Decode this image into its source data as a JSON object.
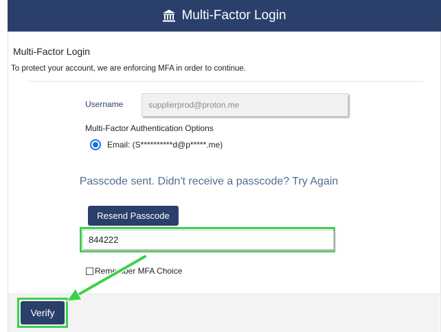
{
  "header": {
    "title": "Multi-Factor Login",
    "icon": "bank-icon"
  },
  "panel": {
    "title": "Multi-Factor Login",
    "subtitle": "To protect your account, we are enforcing MFA in order to continue."
  },
  "form": {
    "username_label": "Username",
    "username_value": "supplierprod@proton.me",
    "mfa_options_label": "Multi-Factor Authentication Options",
    "email_option_label": "Email: (S**********d@p*****.me)",
    "email_option_selected": true,
    "passcode_message": "Passcode sent. Didn't receive a passcode? Try Again",
    "resend_button": "Resend Passcode",
    "passcode_value": "844222",
    "remember_label": "Remember MFA Choice",
    "remember_checked": false
  },
  "footer": {
    "verify_button": "Verify"
  },
  "annotations": {
    "highlight_color": "#3bd14a",
    "arrow_color": "#3bd14a"
  },
  "colors": {
    "primary": "#2b3f6b",
    "radio_accent": "#1e6fe6",
    "message_text": "#4f6f8f"
  }
}
